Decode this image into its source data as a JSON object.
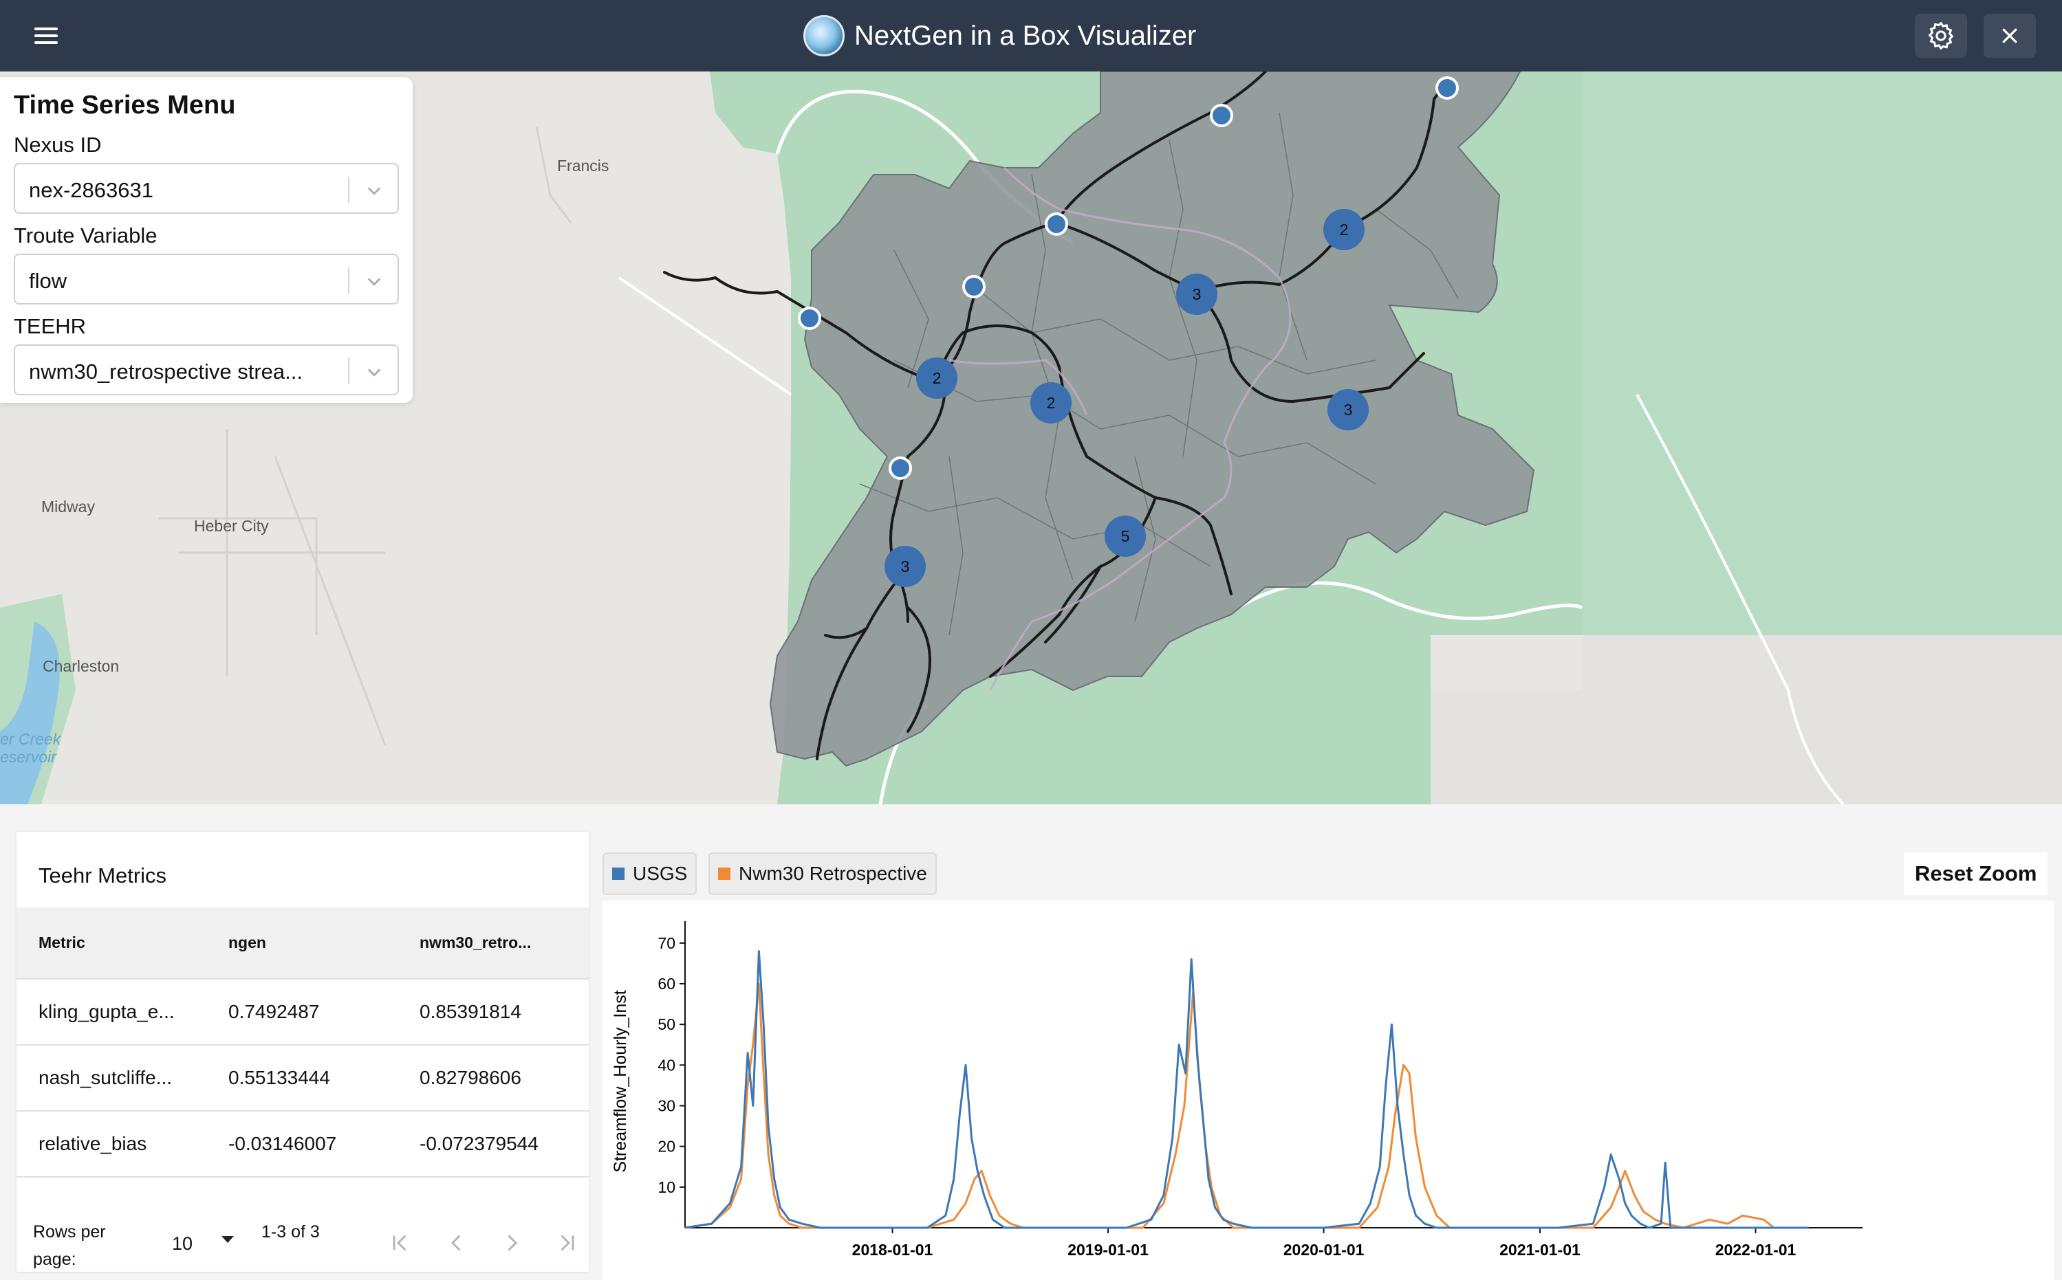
{
  "header": {
    "title": "NextGen in a Box Visualizer"
  },
  "map": {
    "place_labels": [
      "Francis",
      "Midway",
      "Heber City",
      "Charleston",
      "er Creek",
      "eservoir"
    ],
    "cluster_counts": [
      "2",
      "3",
      "2",
      "2",
      "3",
      "5",
      "3"
    ]
  },
  "ts_menu": {
    "title": "Time Series Menu",
    "nexus_label": "Nexus ID",
    "nexus_value": "nex-2863631",
    "variable_label": "Troute Variable",
    "variable_value": "flow",
    "teehr_label": "TEEHR",
    "teehr_value": "nwm30_retrospective strea..."
  },
  "metrics": {
    "title": "Teehr Metrics",
    "columns": [
      "Metric",
      "ngen",
      "nwm30_retro..."
    ],
    "rows": [
      [
        "kling_gupta_e...",
        "0.7492487",
        "0.85391814"
      ],
      [
        "nash_sutcliffe...",
        "0.55133444",
        "0.82798606"
      ],
      [
        "relative_bias",
        "-0.03146007",
        "-0.072379544"
      ]
    ],
    "rows_per_page_label": "Rows per page:",
    "rows_per_page_value": "10",
    "page_range": "1-3 of 3"
  },
  "legend": {
    "usgs": "USGS",
    "nwm30": "Nwm30 Retrospective",
    "reset_zoom": "Reset Zoom"
  },
  "colors": {
    "usgs": "#3b78b5",
    "nwm30": "#f28a35",
    "header_bg": "#2e3a4b",
    "catchment": "#8f9599",
    "forest": "#b2d8bd"
  },
  "chart_data": {
    "type": "line",
    "ylabel": "Streamflow_Hourly_Inst",
    "xlabel": "",
    "ylim": [
      0,
      72
    ],
    "yticks": [
      10,
      20,
      30,
      40,
      50,
      60,
      70
    ],
    "xticks": [
      "2018-01-01",
      "2019-01-01",
      "2020-01-01",
      "2021-01-01",
      "2022-01-01"
    ],
    "xlim": [
      "2017-01-15",
      "2022-07-01"
    ],
    "series": [
      {
        "name": "USGS",
        "x": [
          "2017-01-15",
          "2017-03-01",
          "2017-04-01",
          "2017-04-20",
          "2017-05-01",
          "2017-05-10",
          "2017-05-20",
          "2017-05-28",
          "2017-06-05",
          "2017-06-15",
          "2017-06-25",
          "2017-07-10",
          "2017-08-01",
          "2017-09-01",
          "2017-12-01",
          "2018-03-01",
          "2018-04-01",
          "2018-04-15",
          "2018-04-25",
          "2018-05-05",
          "2018-05-15",
          "2018-05-25",
          "2018-06-05",
          "2018-06-20",
          "2018-07-10",
          "2018-09-01",
          "2019-02-01",
          "2019-03-15",
          "2019-04-05",
          "2019-04-20",
          "2019-05-01",
          "2019-05-12",
          "2019-05-22",
          "2019-06-01",
          "2019-06-10",
          "2019-06-20",
          "2019-07-01",
          "2019-07-15",
          "2019-08-01",
          "2019-09-01",
          "2020-01-01",
          "2020-03-01",
          "2020-03-20",
          "2020-04-05",
          "2020-04-15",
          "2020-04-25",
          "2020-05-05",
          "2020-05-15",
          "2020-05-25",
          "2020-06-05",
          "2020-06-20",
          "2020-07-10",
          "2020-09-01",
          "2021-02-01",
          "2021-04-01",
          "2021-04-20",
          "2021-05-01",
          "2021-05-15",
          "2021-05-25",
          "2021-06-05",
          "2021-06-20",
          "2021-07-05",
          "2021-07-25",
          "2021-08-01",
          "2021-08-10",
          "2022-01-01",
          "2022-04-01"
        ],
        "values": [
          0,
          1,
          6,
          15,
          43,
          30,
          68,
          50,
          25,
          12,
          5,
          2,
          1,
          0,
          0,
          0,
          3,
          12,
          28,
          40,
          22,
          14,
          8,
          2,
          0,
          0,
          0,
          2,
          8,
          22,
          45,
          38,
          66,
          42,
          28,
          12,
          5,
          2,
          1,
          0,
          0,
          1,
          6,
          15,
          35,
          50,
          30,
          18,
          8,
          3,
          1,
          0,
          0,
          0,
          1,
          10,
          18,
          12,
          6,
          3,
          1,
          0,
          1,
          16,
          0,
          0,
          0
        ]
      },
      {
        "name": "Nwm30 Retrospective",
        "x": [
          "2017-01-15",
          "2017-03-01",
          "2017-04-01",
          "2017-04-20",
          "2017-05-01",
          "2017-05-10",
          "2017-05-20",
          "2017-05-28",
          "2017-06-05",
          "2017-06-15",
          "2017-06-25",
          "2017-07-10",
          "2017-08-01",
          "2017-09-01",
          "2018-03-01",
          "2018-04-15",
          "2018-05-05",
          "2018-05-20",
          "2018-06-01",
          "2018-06-15",
          "2018-07-01",
          "2018-07-20",
          "2018-08-10",
          "2019-03-01",
          "2019-04-05",
          "2019-04-25",
          "2019-05-10",
          "2019-05-25",
          "2019-06-05",
          "2019-06-15",
          "2019-06-25",
          "2019-07-10",
          "2019-08-01",
          "2020-03-01",
          "2020-04-01",
          "2020-04-20",
          "2020-05-01",
          "2020-05-15",
          "2020-05-25",
          "2020-06-05",
          "2020-06-20",
          "2020-07-10",
          "2020-08-01",
          "2021-04-01",
          "2021-05-01",
          "2021-05-15",
          "2021-05-25",
          "2021-06-10",
          "2021-06-25",
          "2021-07-15",
          "2021-08-01",
          "2021-09-01",
          "2021-10-15",
          "2021-11-15",
          "2021-12-10",
          "2022-01-15",
          "2022-02-01"
        ],
        "values": [
          0,
          1,
          5,
          12,
          35,
          45,
          60,
          38,
          18,
          8,
          3,
          1,
          0,
          0,
          0,
          2,
          6,
          12,
          14,
          8,
          3,
          1,
          0,
          0,
          6,
          18,
          30,
          58,
          35,
          20,
          10,
          3,
          0,
          0,
          5,
          15,
          28,
          40,
          38,
          22,
          10,
          3,
          0,
          0,
          5,
          10,
          14,
          8,
          4,
          2,
          1,
          0,
          2,
          1,
          3,
          2,
          0
        ]
      }
    ]
  }
}
